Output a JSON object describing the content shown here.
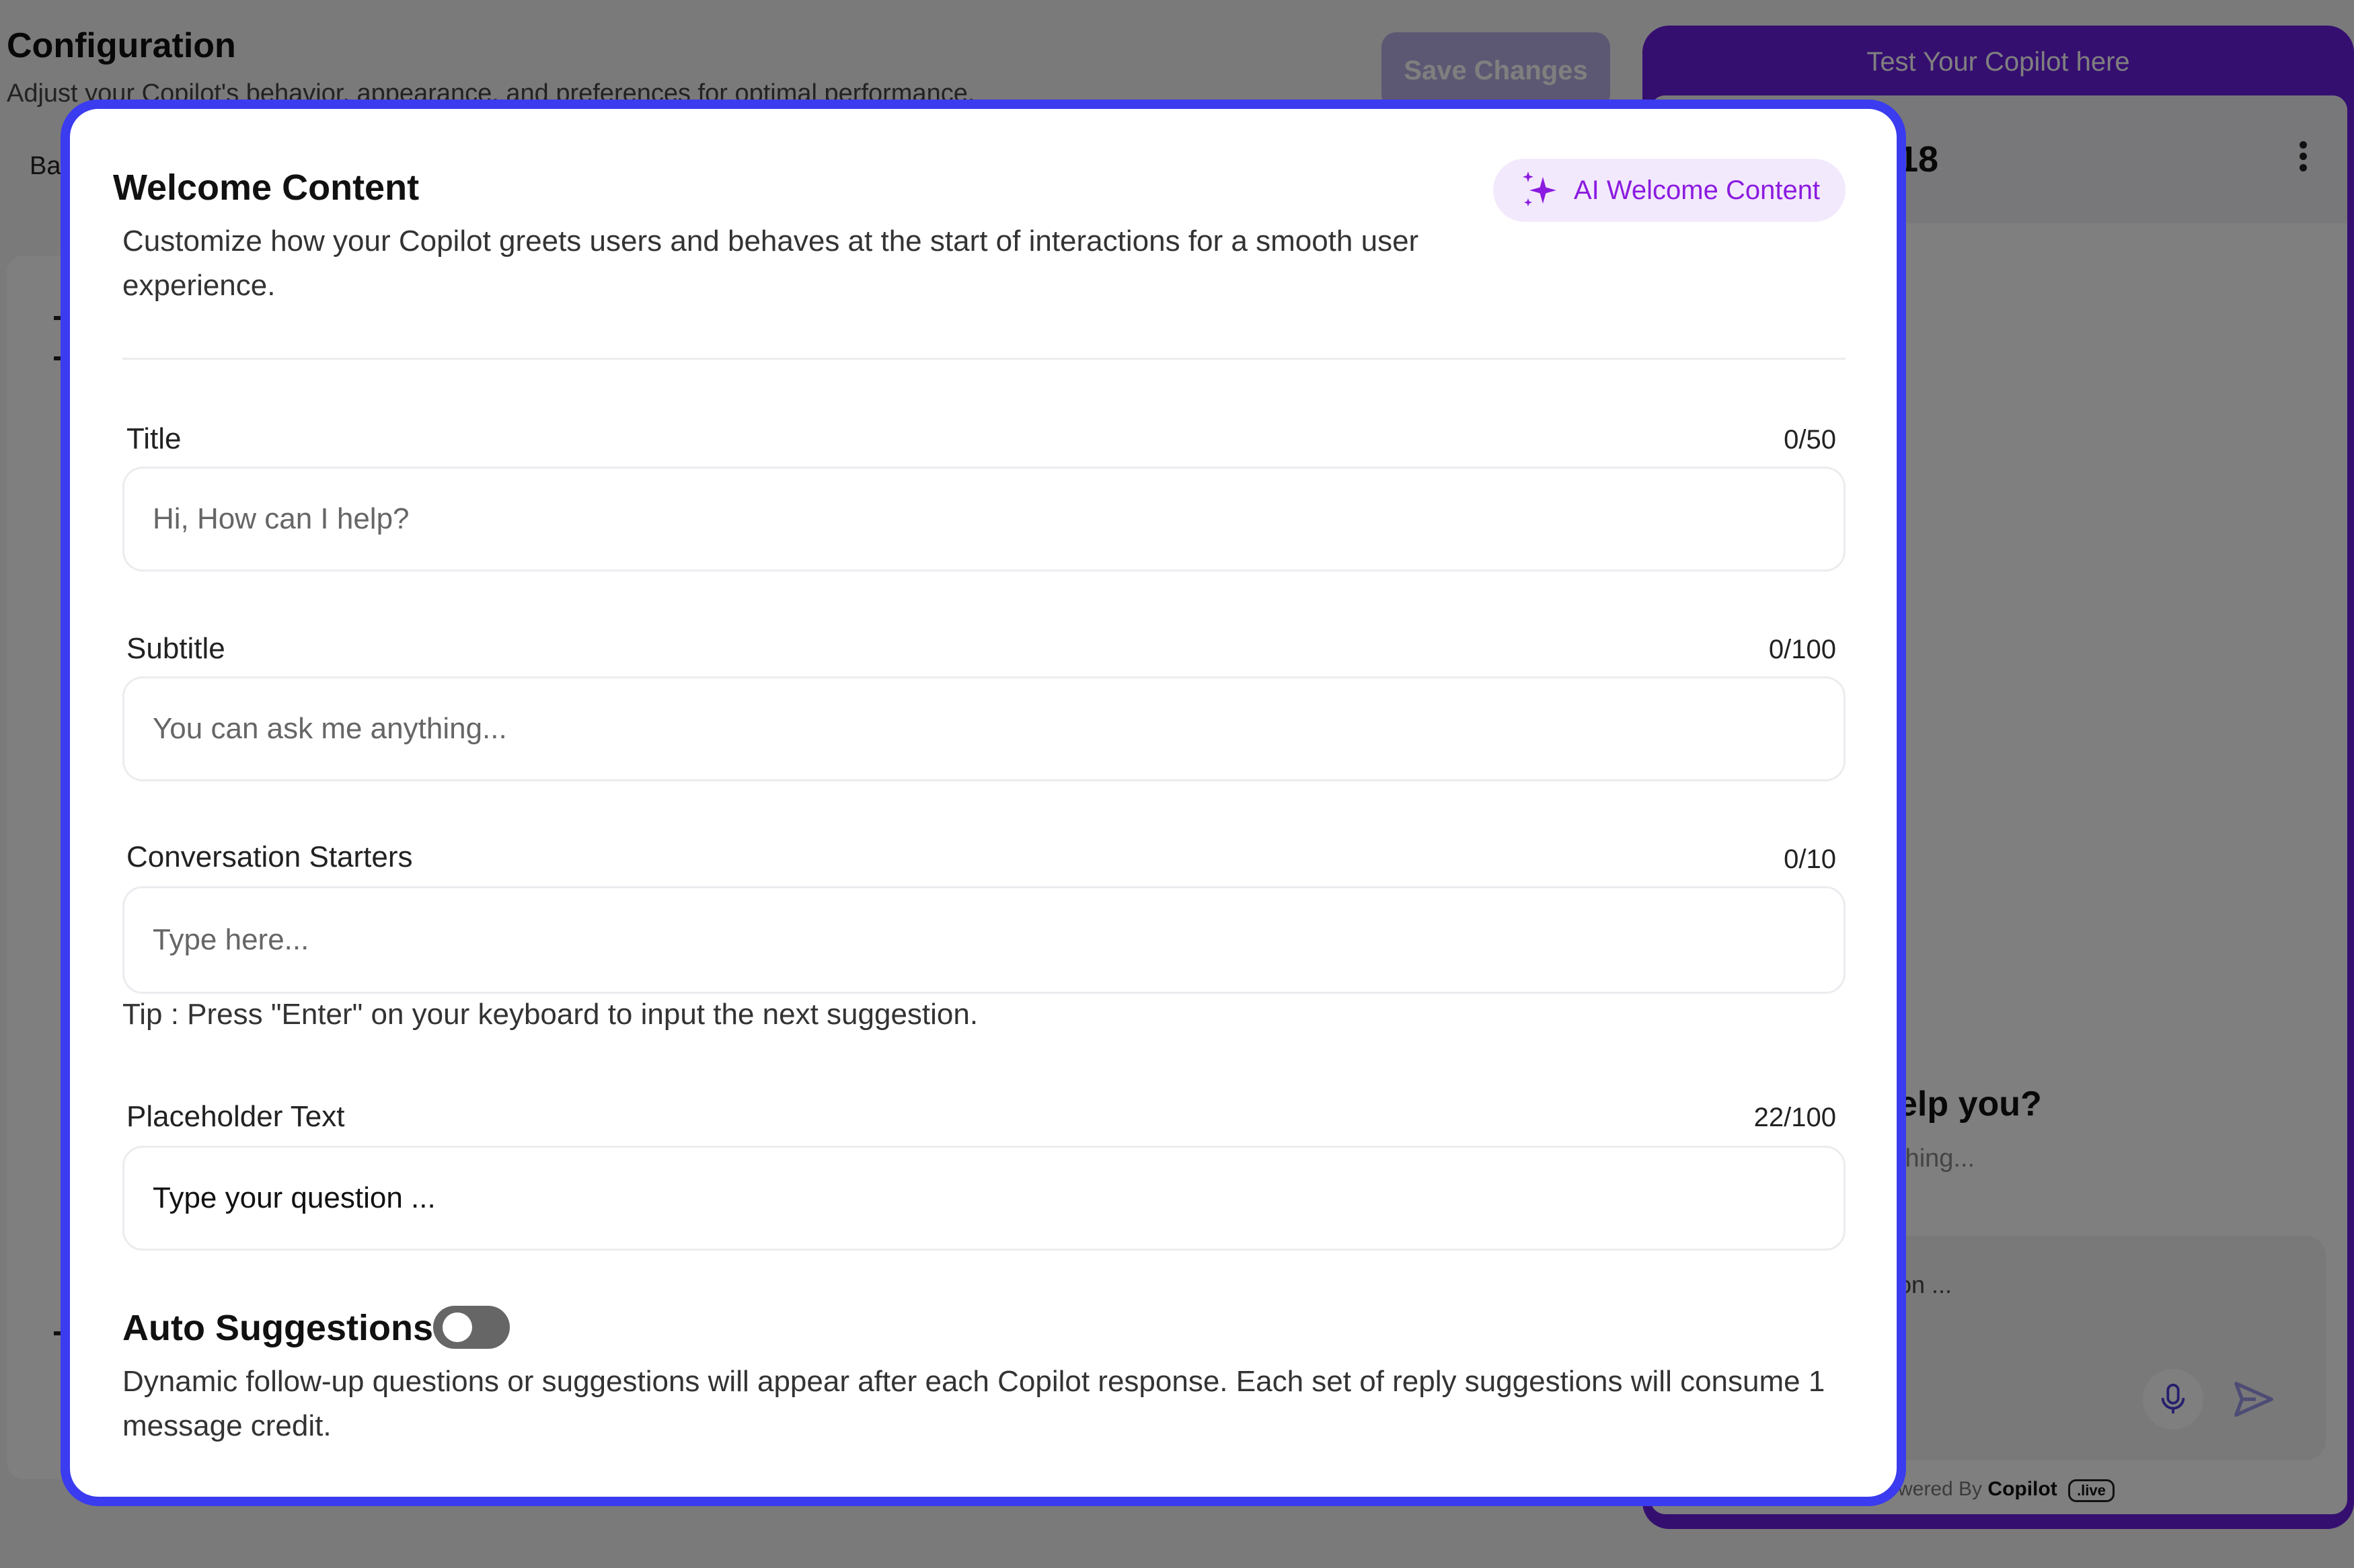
{
  "background": {
    "title": "Configuration",
    "subtitle": "Adjust your Copilot's behavior, appearance, and preferences for optimal performance.",
    "save_label": "Save Changes",
    "tab_partial": "Ba",
    "preview": {
      "header_label": "Test Your Copilot here",
      "bot_name_partial": "18",
      "greeting_partial": "elp you?",
      "sub_partial": "thing...",
      "input_partial": "on ...",
      "powered_prefix": "wered By",
      "powered_brand": "Copilot",
      "powered_badge": ".live"
    }
  },
  "modal": {
    "title": "Welcome Content",
    "description": "Customize how your Copilot greets users and behaves at the start of interactions for a smooth user experience.",
    "ai_button_label": "AI Welcome Content",
    "fields": {
      "title": {
        "label": "Title",
        "count": "0/50",
        "placeholder": "Hi, How can I help?",
        "value": ""
      },
      "subtitle": {
        "label": "Subtitle",
        "count": "0/100",
        "placeholder": "You can ask me anything...",
        "value": ""
      },
      "starters": {
        "label": "Conversation Starters",
        "count": "0/10",
        "placeholder": "Type here...",
        "value": ""
      },
      "placeholder_text": {
        "label": "Placeholder Text",
        "count": "22/100",
        "placeholder": "",
        "value": "Type your question ..."
      }
    },
    "tip": "Tip : Press \"Enter\" on your keyboard to input the next suggestion.",
    "auto_suggestions": {
      "title": "Auto Suggestions",
      "enabled": false,
      "description": "Dynamic follow-up questions or suggestions will appear after each Copilot response. Each set of reply suggestions will consume 1 message credit."
    }
  },
  "colors": {
    "accent": "#3b3bef",
    "brand_purple": "#6a1fe0",
    "ai_button_text": "#8b1be0",
    "ai_button_bg": "#f3e9fd",
    "toggle_off": "#666666"
  },
  "icons": {
    "ai_button": "sparkles-icon",
    "menu": "kebab-menu-icon",
    "mic": "microphone-icon",
    "send": "send-icon"
  }
}
